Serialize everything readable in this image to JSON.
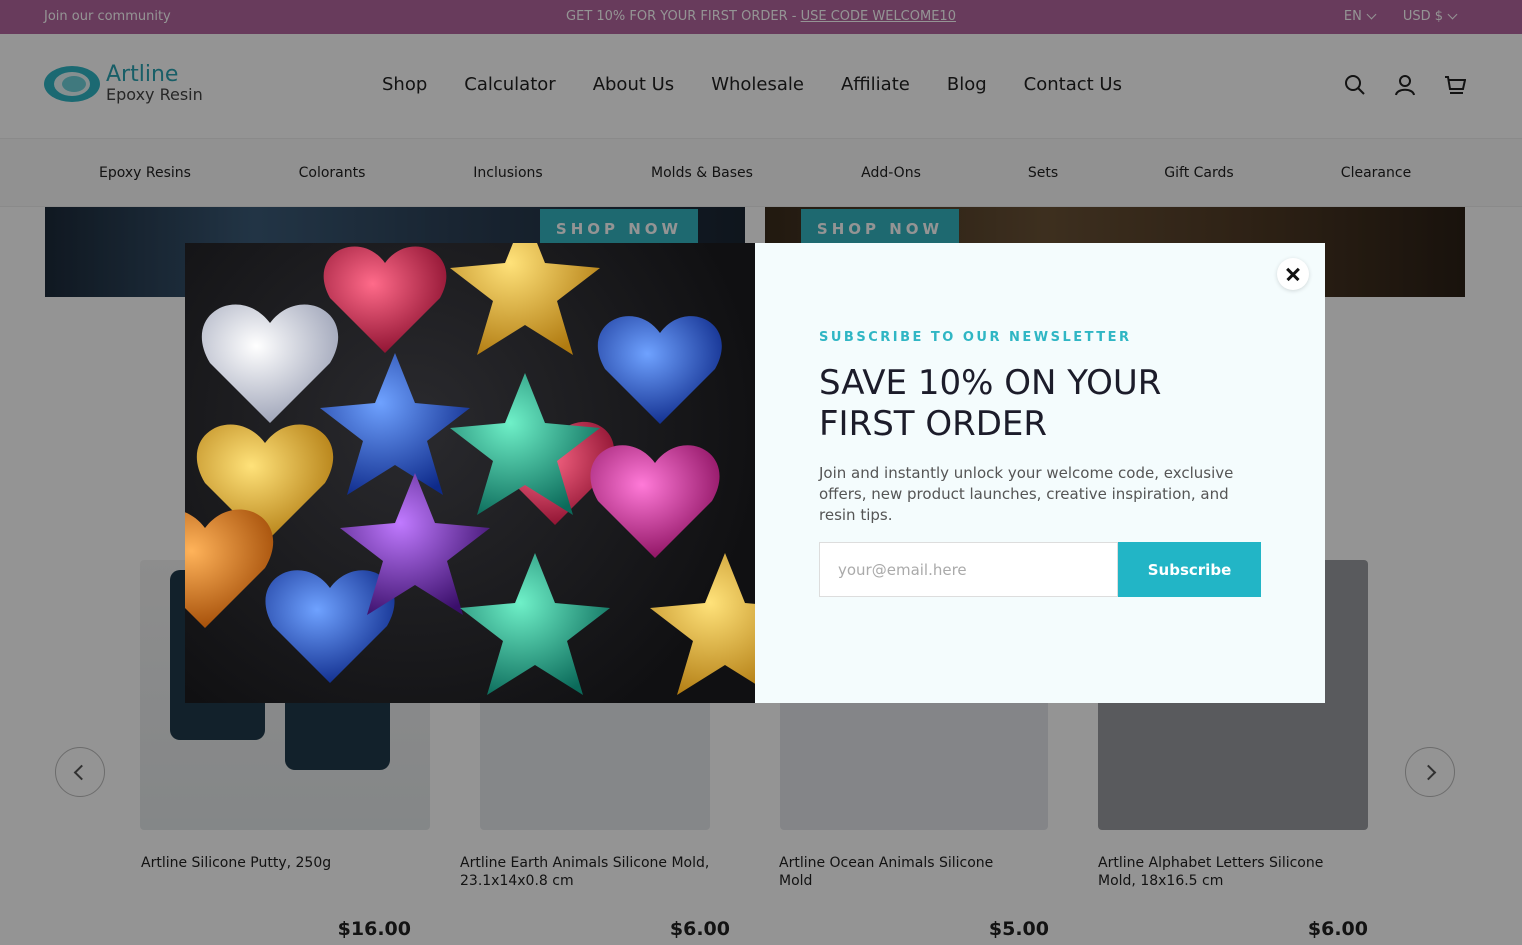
{
  "announcement": {
    "left": "Join our community",
    "center_text": "GET 10% FOR YOUR FIRST ORDER - ",
    "center_code": "USE CODE WELCOME10",
    "language": "EN",
    "currency": "USD $"
  },
  "header": {
    "logo_line1": "Artline",
    "logo_line2": "Epoxy Resin",
    "nav": [
      "Shop",
      "Calculator",
      "About Us",
      "Wholesale",
      "Affiliate",
      "Blog",
      "Contact Us"
    ],
    "icons": [
      "search-icon",
      "account-icon",
      "cart-icon"
    ]
  },
  "subnav": [
    "Epoxy Resins",
    "Colorants",
    "Inclusions",
    "Molds & Bases",
    "Add-Ons",
    "Sets",
    "Gift Cards",
    "Clearance"
  ],
  "banners": [
    {
      "cta": "SHOP NOW"
    },
    {
      "cta": "SHOP NOW"
    }
  ],
  "products": [
    {
      "name": "Artline Silicone Putty, 250g",
      "price": "$16.00"
    },
    {
      "name": "Artline Earth Animals Silicone Mold, 23.1x14x0.8 cm",
      "price": "$6.00"
    },
    {
      "name": "Artline Ocean Animals Silicone Mold",
      "price": "$5.00"
    },
    {
      "name": "Artline Alphabet Letters Silicone Mold, 18x16.5 cm",
      "price": "$6.00"
    }
  ],
  "modal": {
    "eyebrow": "SUBSCRIBE TO OUR NEWSLETTER",
    "headline": "SAVE 10% ON YOUR FIRST ORDER",
    "description": "Join and instantly unlock your welcome code, exclusive offers, new product launches, creative inspiration, and resin tips.",
    "email_placeholder": "your@email.here",
    "subscribe_label": "Subscribe",
    "accent": "#22b5c6"
  }
}
